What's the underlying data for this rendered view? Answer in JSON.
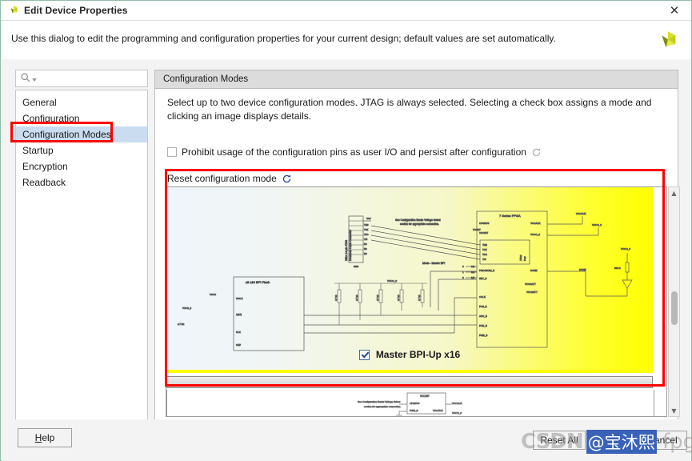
{
  "window": {
    "title": "Edit Device Properties",
    "close_label": "✕",
    "logo_icon": "xilinx-logo-icon",
    "banner_text": "Use this dialog to edit the programming and configuration properties for your current design; default values are set automatically."
  },
  "sidebar": {
    "search": {
      "value": "",
      "placeholder": "",
      "icon": "search-icon"
    },
    "items": [
      {
        "label": "General",
        "selected": false
      },
      {
        "label": "Configuration",
        "selected": false
      },
      {
        "label": "Configuration Modes",
        "selected": true
      },
      {
        "label": "Startup",
        "selected": false
      },
      {
        "label": "Encryption",
        "selected": false
      },
      {
        "label": "Readback",
        "selected": false
      }
    ]
  },
  "main": {
    "header": "Configuration Modes",
    "description": "Select up to two device configuration modes. JTAG is always selected. Selecting a check box assigns a mode and clicking an image displays details.",
    "prohibit": {
      "label": "Prohibit usage of the configuration pins as user I/O and persist after configuration",
      "checked": false,
      "reset_icon": "reset-circular-arrow-icon"
    },
    "reset_mode": {
      "label": "Reset configuration mode",
      "reset_icon": "reset-circular-arrow-icon"
    },
    "modes": [
      {
        "label": "Master BPI-Up x16",
        "checked": true
      }
    ],
    "schematic": {
      "fpga_block": "7 Series FPGA",
      "flash_block": "x8 x16 BPI Flash",
      "mode_note": "Mode - Master BPI",
      "jtag_note": "Xilinx 14-pin JTAG\nDownload Cable Connector",
      "voltage_note": "See Configuration Banks Voltage Select\nsection for appropriate connection.",
      "mode_pins": [
        "M2",
        "M1",
        "M0"
      ],
      "mode_values": [
        "0",
        "1",
        "0"
      ],
      "jtag_signals": [
        "TMS",
        "TCK",
        "TDO",
        "TDI"
      ],
      "fpga_pins": [
        "PROGRAM_B",
        "INIT_B",
        "DONE",
        "CCLK",
        "VCCINT",
        "VCCAUX",
        "VCCO_0",
        "VCCBATT",
        "CFGBVS",
        "PWR_B"
      ],
      "resistor_values": [
        "4.7 kΩ",
        "4.7 kΩ",
        "4.7 kΩ",
        "4.7 kΩ"
      ]
    }
  },
  "scrollbar": {
    "up_arrow": "▲",
    "down_arrow": "▼"
  },
  "footer": {
    "help_label": "Help",
    "help_mnemonic": "H",
    "reset_all_label": "Reset All",
    "cancel_label": "Cancel"
  },
  "watermark": {
    "site": "CSDN",
    "user": "@宝沐熙",
    "tail": "-fpga"
  },
  "colors": {
    "accent_yellow": "#ffff00",
    "selection_blue": "#cadcf0",
    "annotation_red": "#ff0000",
    "brand_olive": "#a8b400"
  }
}
